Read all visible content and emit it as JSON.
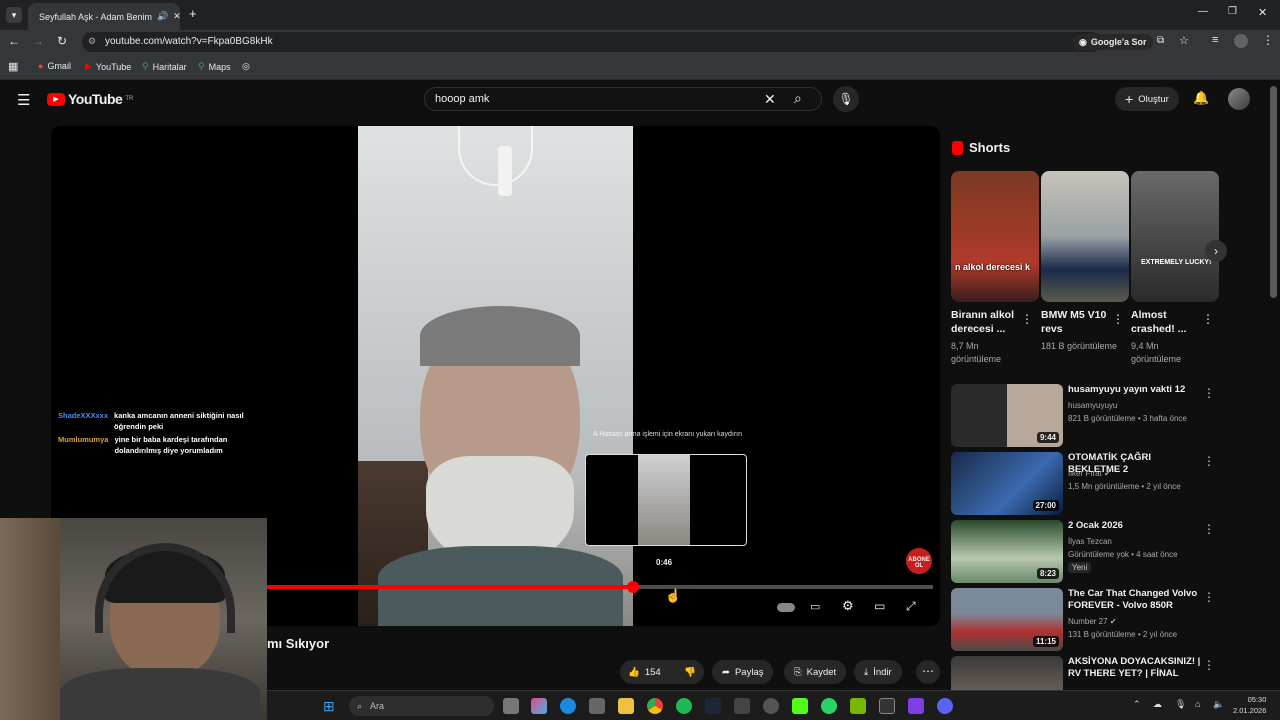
{
  "browser": {
    "tab_title": "Seyfullah Aşk - Adam Benim",
    "url": "youtube.com/watch?v=Fkpa0BG8kHk",
    "google_ask": "Google'a Sor",
    "bookmarks": [
      "Gmail",
      "YouTube",
      "Haritalar",
      "Maps"
    ]
  },
  "header": {
    "logo": "YouTube",
    "region": "TR",
    "search_value": "hooop amk",
    "create_label": "Oluştur"
  },
  "chat": [
    {
      "user": "ShadeXXXxxx",
      "message": "kanka amcanın anneni siktiğini nasıl öğrendin peki",
      "color": "#4a8cf0"
    },
    {
      "user": "Mumlumumya",
      "message": "yine bir baba kardeşi tarafından dolandırılmış diye yorumladım",
      "color": "#e0a040"
    }
  ],
  "player": {
    "overlay_hint": "A Hassas arma işlemi için ekranı yukarı kaydırın",
    "preview_time": "0:46",
    "progress": 0.55,
    "subscribe_badge": "ABONE OL"
  },
  "video": {
    "title_fragment": "mı Sıkıyor",
    "likes": "154",
    "share": "Paylaş",
    "save": "Kaydet",
    "download": "İndir"
  },
  "shorts": {
    "heading": "Shorts",
    "items": [
      {
        "title": "Biranın alkol derecesi ...",
        "views": "8,7 Mn görüntüleme",
        "overlay": "n alkol derecesi k"
      },
      {
        "title": "BMW M5 V10 revs",
        "views": "181 B görüntüleme",
        "overlay": ""
      },
      {
        "title": "Almost crashed! ...",
        "views": "9,4 Mn görüntüleme",
        "overlay": "EXTREMELY LUCKY!"
      }
    ]
  },
  "related": [
    {
      "title": "husamyuyu yayın vakti 12",
      "channel": "husamyuyuyu",
      "meta": "821 B görüntüleme • 3 hafta önce",
      "duration": "9:44",
      "badge": ""
    },
    {
      "title": "OTOMATİK ÇAĞRI BEKLETME 2",
      "channel": "İlker Fırat",
      "meta": "1,5 Mn görüntüleme • 2 yıl önce",
      "duration": "27:00",
      "badge": ""
    },
    {
      "title": "2 Ocak 2026",
      "channel": "İlyas Tezcan",
      "meta": "Görüntüleme yok • 4 saat önce",
      "duration": "8:23",
      "badge": "Yeni"
    },
    {
      "title": "The Car That Changed Volvo FOREVER - Volvo 850R",
      "channel": "Number 27",
      "meta": "131 B görüntüleme • 2 yıl önce",
      "duration": "11:15",
      "badge": ""
    },
    {
      "title": "AKSİYONA DOYACAKSINIZ! | RV THERE YET? | FİNAL",
      "channel": "",
      "meta": "",
      "duration": "",
      "badge": ""
    }
  ],
  "taskbar": {
    "search_placeholder": "Ara",
    "time": "05:30",
    "date": "2.01.2026"
  }
}
